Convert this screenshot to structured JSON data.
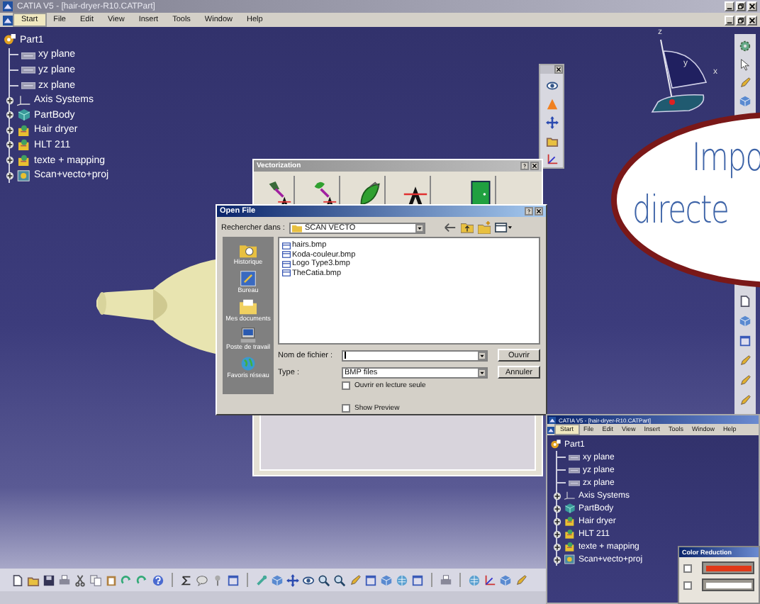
{
  "window": {
    "title": "CATIA V5 - [hair-dryer-R10.CATPart]",
    "menu": [
      {
        "label": "Start",
        "selected": true
      },
      {
        "label": "File",
        "selected": false
      },
      {
        "label": "Edit",
        "selected": false
      },
      {
        "label": "View",
        "selected": false
      },
      {
        "label": "Insert",
        "selected": false
      },
      {
        "label": "Tools",
        "selected": false
      },
      {
        "label": "Window",
        "selected": false
      },
      {
        "label": "Help",
        "selected": false
      }
    ]
  },
  "tree": {
    "root": "Part1",
    "children": [
      {
        "label": "xy plane",
        "kind": "plane"
      },
      {
        "label": "yz plane",
        "kind": "plane"
      },
      {
        "label": "zx plane",
        "kind": "plane"
      },
      {
        "label": "Axis Systems",
        "kind": "axis"
      },
      {
        "label": "PartBody",
        "kind": "body"
      },
      {
        "label": "Hair dryer",
        "kind": "geoset"
      },
      {
        "label": "HLT 211",
        "kind": "geoset"
      },
      {
        "label": "texte + mapping",
        "kind": "geoset"
      },
      {
        "label": "Scan+vecto+proj",
        "kind": "scan"
      }
    ]
  },
  "compass": {
    "labels": [
      "z",
      "y",
      "x"
    ]
  },
  "vectorization": {
    "title": "Vectorization"
  },
  "open_file": {
    "title": "Open File",
    "look_in_label": "Rechercher dans :",
    "folder": "SCAN VECTO",
    "places": [
      {
        "label": "Historique",
        "kind": "history"
      },
      {
        "label": "Bureau",
        "kind": "desktop"
      },
      {
        "label": "Mes documents",
        "kind": "documents"
      },
      {
        "label": "Poste de travail",
        "kind": "computer"
      },
      {
        "label": "Favoris réseau",
        "kind": "network"
      }
    ],
    "files": [
      "hairs.bmp",
      "Koda-couleur.bmp",
      "Logo Type3.bmp",
      "TheCatia.bmp"
    ],
    "file_name_label": "Nom de fichier :",
    "type_label": "Type :",
    "type_value": "BMP files",
    "open_button": "Ouvrir",
    "cancel_button": "Annuler",
    "options": [
      {
        "label": "Ouvrir en lecture seule",
        "checked": false
      },
      {
        "label": "Show Preview",
        "checked": false
      }
    ]
  },
  "callout": {
    "lines": [
      "Impo",
      "directe"
    ]
  },
  "second_window": {
    "title": "CATIA V5 - [hair-dryer-R10.CATPart]",
    "menu": [
      {
        "label": "Start",
        "selected": true
      },
      {
        "label": "File",
        "selected": false
      },
      {
        "label": "Edit",
        "selected": false
      },
      {
        "label": "View",
        "selected": false
      },
      {
        "label": "Insert",
        "selected": false
      },
      {
        "label": "Tools",
        "selected": false
      },
      {
        "label": "Window",
        "selected": false
      },
      {
        "label": "Help",
        "selected": false
      }
    ],
    "tree": {
      "root": "Part1",
      "children": [
        {
          "label": "xy plane",
          "kind": "plane"
        },
        {
          "label": "yz plane",
          "kind": "plane"
        },
        {
          "label": "zx plane",
          "kind": "plane"
        },
        {
          "label": "Axis Systems",
          "kind": "axis"
        },
        {
          "label": "PartBody",
          "kind": "body"
        },
        {
          "label": "Hair dryer",
          "kind": "geoset"
        },
        {
          "label": "HLT 211",
          "kind": "geoset"
        },
        {
          "label": "texte + mapping",
          "kind": "geoset"
        },
        {
          "label": "Scan+vecto+proj",
          "kind": "scan"
        }
      ]
    }
  },
  "color_reduction": {
    "title": "Color Reduction",
    "rows": [
      {
        "checked": false,
        "color": "#e03818"
      },
      {
        "checked": false,
        "color": "#ffffff"
      }
    ]
  }
}
